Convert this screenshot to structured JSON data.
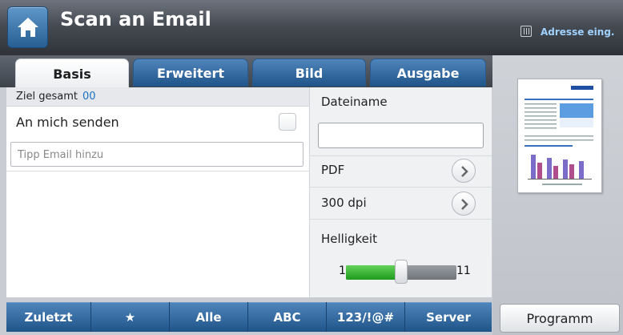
{
  "header": {
    "title": "Scan an Email",
    "address_label": "Adresse eing.",
    "home_icon": "home-icon",
    "address_icon": "address-book-icon"
  },
  "tabs": [
    {
      "label": "Basis",
      "active": true
    },
    {
      "label": "Erweitert",
      "active": false
    },
    {
      "label": "Bild",
      "active": false
    },
    {
      "label": "Ausgabe",
      "active": false
    }
  ],
  "recipients": {
    "total_label": "Ziel gesamt",
    "total_count": "00",
    "send_to_me_label": "An mich senden",
    "send_to_me_checked": false,
    "email_placeholder": "Tipp Email hinzu"
  },
  "options": {
    "filename_label": "Dateiname",
    "filename_value": "",
    "format_value": "PDF",
    "resolution_value": "300 dpi",
    "brightness_label": "Helligkeit",
    "brightness_min": "1",
    "brightness_max": "11",
    "brightness_value": 6
  },
  "bottom_bar": {
    "items": [
      "Zuletzt",
      "★",
      "Alle",
      "ABC",
      "123/!@#",
      "Server"
    ]
  },
  "sidebar": {
    "program_label": "Programm"
  },
  "colors": {
    "accent_blue": "#1f5489",
    "slider_green": "#1e9a1c",
    "count_blue": "#1d6fc3"
  }
}
